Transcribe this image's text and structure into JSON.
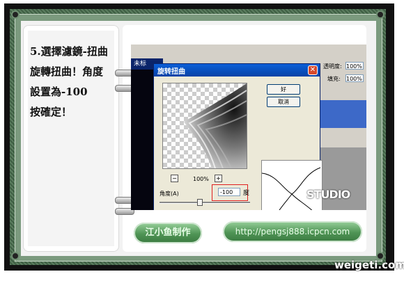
{
  "instruction": {
    "line1": "5.選擇濾鏡-扭曲",
    "line2": "旋轉扭曲！角度",
    "line3": "設置為-100",
    "line4": "按確定！"
  },
  "photoshop": {
    "doc_title": "未标",
    "layers": {
      "opacity_label": "透明度:",
      "opacity_value": "100%",
      "fill_label": "填充:",
      "fill_value": "100%"
    }
  },
  "dialog": {
    "title": "旋转扭曲",
    "close_symbol": "✕",
    "ok_label": "好",
    "cancel_label": "取消",
    "zoom_out_symbol": "−",
    "zoom_in_symbol": "+",
    "zoom_value": "100%",
    "angle_label": "角度(A)",
    "angle_value": "-100",
    "angle_unit": "度"
  },
  "footer": {
    "author_button": "江小鱼制作",
    "url_button": "http://pengsj888.icpcn.com",
    "studio_mark": "STUDIO",
    "site_watermark": "weigeti.com"
  }
}
